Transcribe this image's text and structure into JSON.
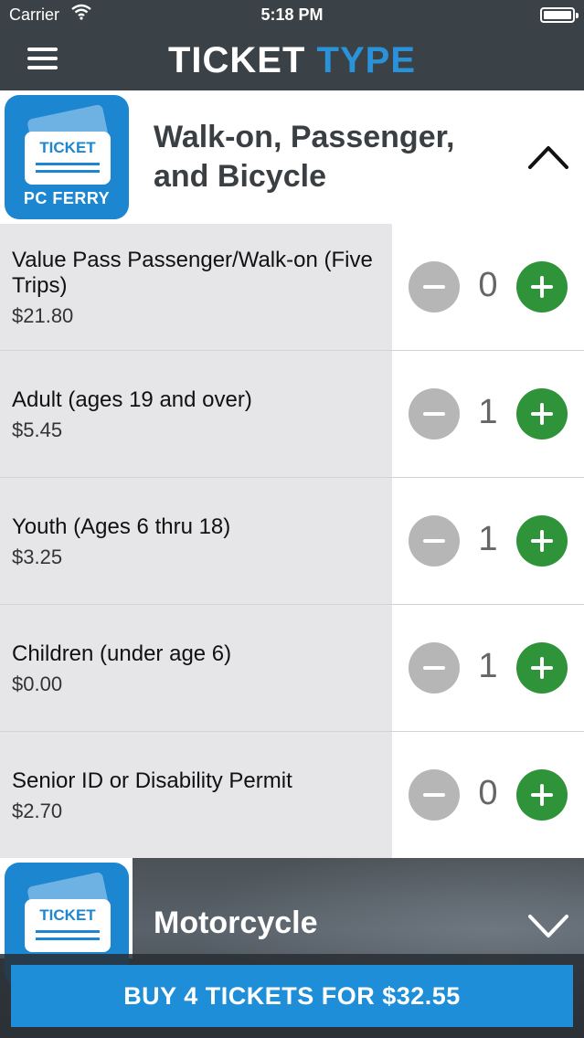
{
  "status_bar": {
    "carrier": "Carrier",
    "time": "5:18 PM"
  },
  "header": {
    "title_word1": "TICKET",
    "title_word2": "TYPE"
  },
  "logo": {
    "card_text": "TICKET",
    "name": "PC FERRY"
  },
  "section_expanded": {
    "title": "Walk-on, Passenger, and Bicycle"
  },
  "tickets": [
    {
      "name": "Value Pass Passenger/Walk-on (Five Trips)",
      "price": "$21.80",
      "count": "0"
    },
    {
      "name": "Adult (ages 19 and over)",
      "price": "$5.45",
      "count": "1"
    },
    {
      "name": "Youth (Ages 6 thru 18)",
      "price": "$3.25",
      "count": "1"
    },
    {
      "name": "Children (under age 6)",
      "price": "$0.00",
      "count": "1"
    },
    {
      "name": "Senior ID or Disability Permit",
      "price": "$2.70",
      "count": "0"
    }
  ],
  "section_collapsed": {
    "title": "Motorcycle"
  },
  "buy_button": {
    "label": "BUY 4 TICKETS FOR $32.55"
  },
  "colors": {
    "header_bg": "#3b4247",
    "accent_blue": "#2a92d8",
    "plus_green": "#2f9439",
    "minus_gray": "#b6b6b6"
  }
}
